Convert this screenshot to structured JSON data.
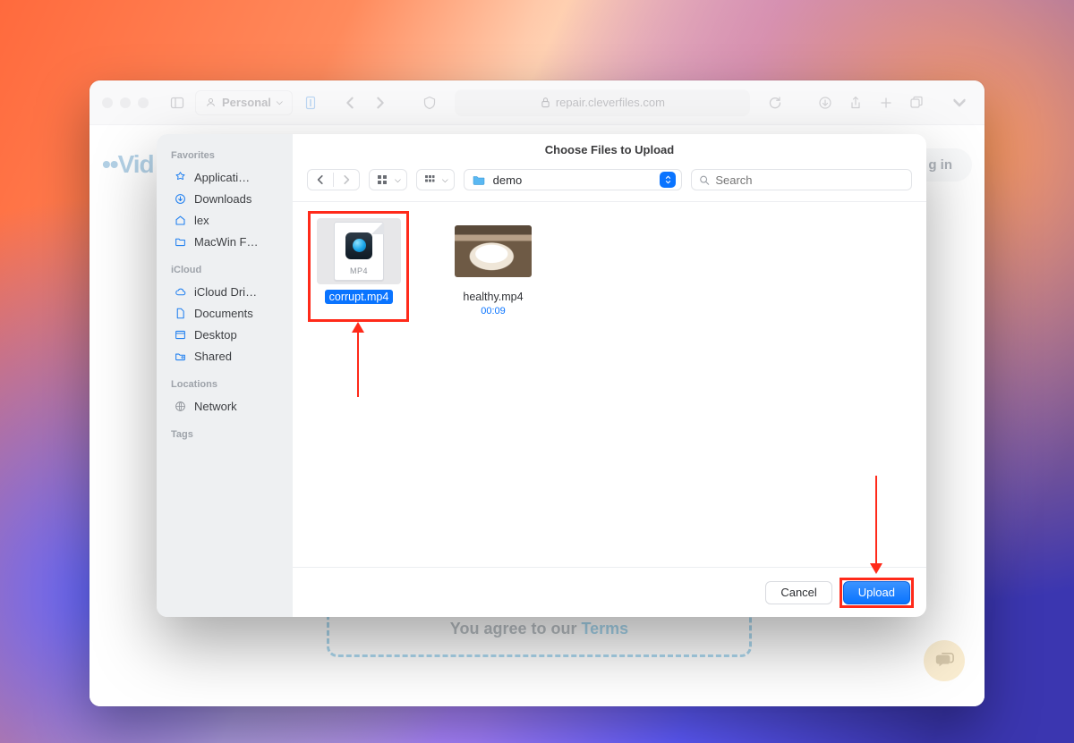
{
  "browser": {
    "profile_label": "Personal",
    "url_host": "repair.cleverfiles.com"
  },
  "page": {
    "logo_text": "Vid",
    "login_label": "g in",
    "agree_prefix": "You agree to our ",
    "agree_link": "Terms"
  },
  "dialog": {
    "title": "Choose Files to Upload",
    "search_placeholder": "Search",
    "current_folder": "demo",
    "sidebar": {
      "favorites_header": "Favorites",
      "favorites": [
        {
          "icon": "apps",
          "label": "Applicati…"
        },
        {
          "icon": "download",
          "label": "Downloads"
        },
        {
          "icon": "home",
          "label": "lex"
        },
        {
          "icon": "folder",
          "label": "MacWin F…"
        }
      ],
      "icloud_header": "iCloud",
      "icloud": [
        {
          "icon": "cloud",
          "label": "iCloud Dri…"
        },
        {
          "icon": "doc",
          "label": "Documents"
        },
        {
          "icon": "desktop",
          "label": "Desktop"
        },
        {
          "icon": "shared",
          "label": "Shared"
        }
      ],
      "locations_header": "Locations",
      "locations": [
        {
          "icon": "globe",
          "label": "Network"
        }
      ],
      "tags_header": "Tags"
    },
    "files": [
      {
        "name": "corrupt.mp4",
        "ext": "MP4",
        "type": "doc",
        "selected": true
      },
      {
        "name": "healthy.mp4",
        "type": "video",
        "duration": "00:09",
        "selected": false
      }
    ],
    "buttons": {
      "cancel": "Cancel",
      "upload": "Upload"
    }
  }
}
